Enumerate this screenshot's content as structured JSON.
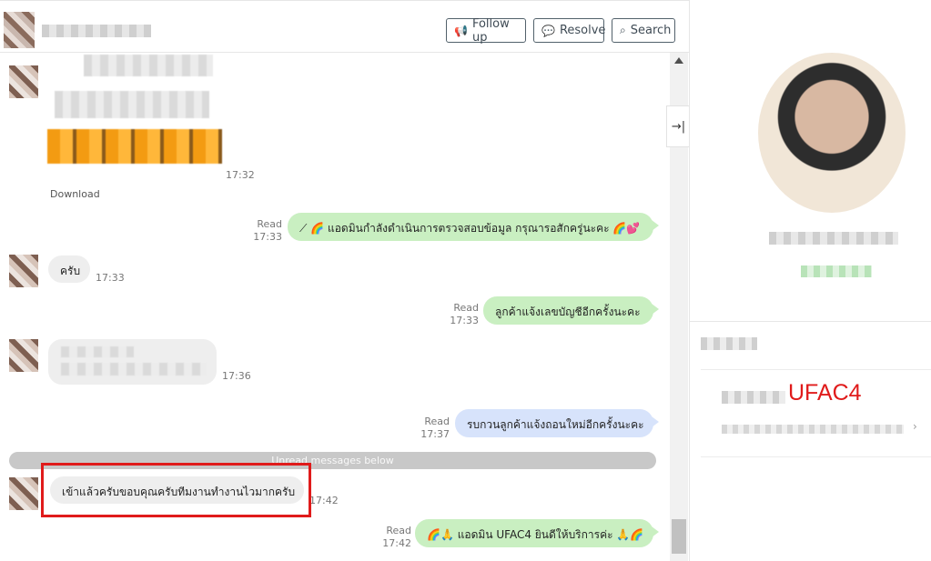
{
  "header": {
    "buttons": {
      "follow_up": "Follow up",
      "resolve": "Resolve",
      "search": "Search"
    },
    "icons": {
      "follow_up": "megaphone-icon",
      "resolve": "speech-bubble-icon",
      "search": "search-icon"
    }
  },
  "messages": {
    "m1": {
      "time": "17:32",
      "download_label": "Download"
    },
    "m2": {
      "status": "Read",
      "time": "17:33",
      "text": "⟋ 🌈 แอดมินกำลังดำเนินการตรวจสอบข้อมูล กรุณารอสักครู่นะคะ 🌈💕"
    },
    "m3": {
      "text": "ครับ",
      "time": "17:33"
    },
    "m4": {
      "status": "Read",
      "time": "17:33",
      "text": "ลูกค้าแจ้งเลขบัญชีอีกครั้งนะคะ"
    },
    "m5": {
      "time": "17:36"
    },
    "m6": {
      "status": "Read",
      "time": "17:37",
      "text": "รบกวนลูกค้าแจ้งถอนใหม่อีกครั้งนะคะ"
    },
    "unread_divider": "Unread messages below",
    "m7": {
      "text": "เข้าแล้วครับขอบคุณครับทีมงานทำงานไวมากครับ",
      "time": "17:42"
    },
    "m8": {
      "status": "Read",
      "time": "17:42",
      "text": "🌈🙏 แอดมิน UFAC4 ยินดีให้บริการค่ะ 🙏🌈"
    }
  },
  "right_panel": {
    "overlay_label": "UFAC4",
    "collapse_icon": "collapse-right-icon"
  },
  "colors": {
    "outgoing_bubble": "#c9efc1",
    "incoming_bubble": "#eeeeee",
    "blue_bubble": "#d7e3fb",
    "highlight": "#e01b1b"
  }
}
